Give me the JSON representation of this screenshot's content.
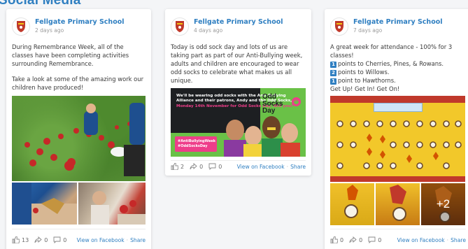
{
  "section": {
    "title": "Social Media"
  },
  "posts": [
    {
      "author": "Fellgate Primary School",
      "date": "2 days ago",
      "paragraphs": [
        "During Remembrance Week, all of the classes have been completing activities surrounding Remembrance.",
        "Take a look at some of the amazing work our children have produced!"
      ],
      "likes": "13",
      "shares": "0",
      "comments": "0",
      "link_view": "View on Facebook",
      "link_share": "Share"
    },
    {
      "author": "Fellgate Primary School",
      "date": "4 days ago",
      "paragraphs": [
        "Today is odd sock day and lots of us are taking part as part of our Anti-Bullying week, adults and children are encouraged to wear odd socks to celebrate what makes us all unique."
      ],
      "banner": {
        "line1": "We'll be wearing odd socks with",
        "line2": "the Anti-Bullying Alliance and their",
        "line3": "patrons, Andy and the Odd Socks,",
        "line4": "on Monday 14th November for Odd",
        "line5": "Socks Day. Will you?",
        "tag1": "#AntiBullyingWeek",
        "tag2": "#OddSocksDay",
        "word1": "Odd",
        "word2": "Socks",
        "word3": "Day"
      },
      "likes": "2",
      "shares": "0",
      "comments": "0",
      "link_view": "View on Facebook",
      "link_share": "Share"
    },
    {
      "author": "Fellgate Primary School",
      "date": "7 days ago",
      "intro": "A great week for attendance - 100% for 3 classes!",
      "ranks": [
        {
          "n": "1",
          "text": "points to Cherries, Pines, & Rowans."
        },
        {
          "n": "2",
          "text": "points to Willows."
        },
        {
          "n": "1",
          "text": "point to Hawthorns."
        }
      ],
      "outro": "Get Up! Get In! Get On!",
      "more_photos": "+2",
      "likes": "0",
      "shares": "0",
      "comments": "0",
      "link_view": "View on Facebook",
      "link_share": "Share"
    }
  ],
  "colors": {
    "accent": "#2f7fc1",
    "text": "#3a3a3a",
    "muted": "#9a9a9a"
  },
  "icons": {
    "like": "thumbs-up-icon",
    "share": "share-arrow-icon",
    "comment": "comment-bubble-icon",
    "crest": "school-crest-icon"
  }
}
